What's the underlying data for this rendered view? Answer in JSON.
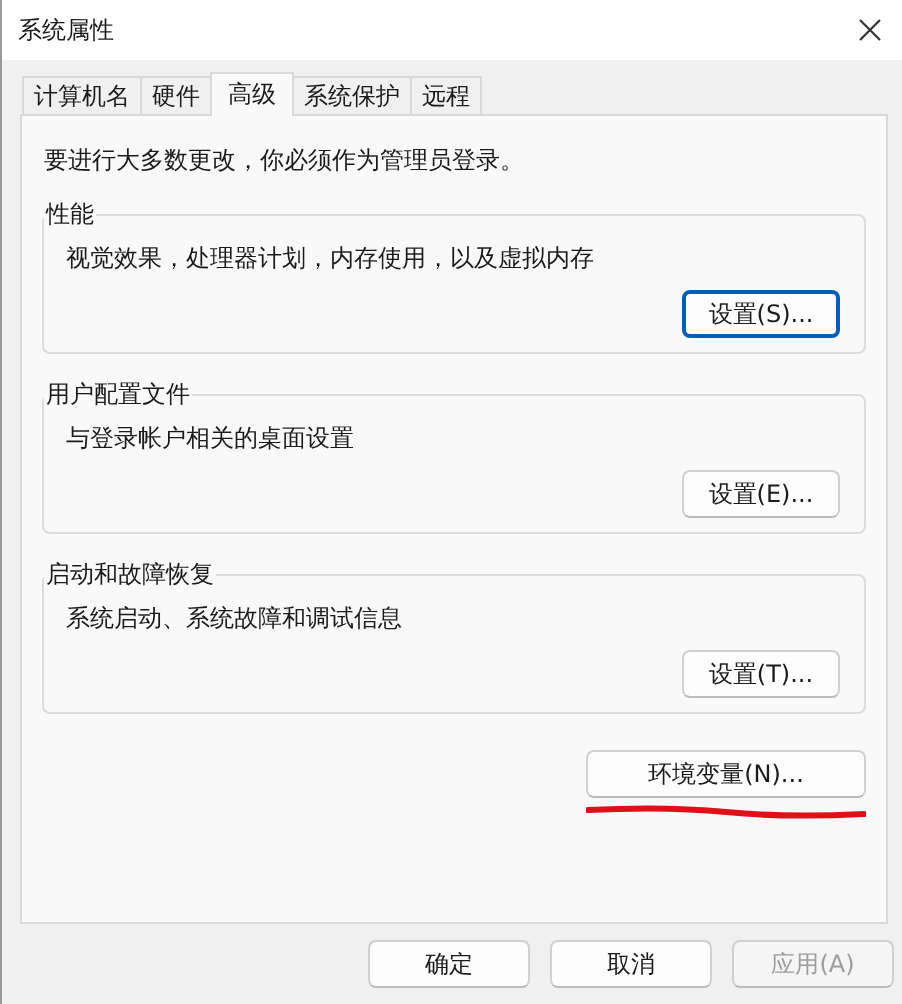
{
  "window": {
    "title": "系统属性"
  },
  "tabs": [
    {
      "label": "计算机名",
      "selected": false
    },
    {
      "label": "硬件",
      "selected": false
    },
    {
      "label": "高级",
      "selected": true
    },
    {
      "label": "系统保护",
      "selected": false
    },
    {
      "label": "远程",
      "selected": false
    }
  ],
  "notice": "要进行大多数更改，你必须作为管理员登录。",
  "groups": [
    {
      "title": "性能",
      "description": "视觉效果，处理器计划，内存使用，以及虚拟内存",
      "button": "设置(S)...",
      "focused": true
    },
    {
      "title": "用户配置文件",
      "description": "与登录帐户相关的桌面设置",
      "button": "设置(E)...",
      "focused": false
    },
    {
      "title": "启动和故障恢复",
      "description": "系统启动、系统故障和调试信息",
      "button": "设置(T)...",
      "focused": false
    }
  ],
  "environment_button": "环境变量(N)...",
  "footer_buttons": [
    {
      "label": "确定",
      "disabled": false
    },
    {
      "label": "取消",
      "disabled": false
    },
    {
      "label": "应用(A)",
      "disabled": true
    }
  ]
}
